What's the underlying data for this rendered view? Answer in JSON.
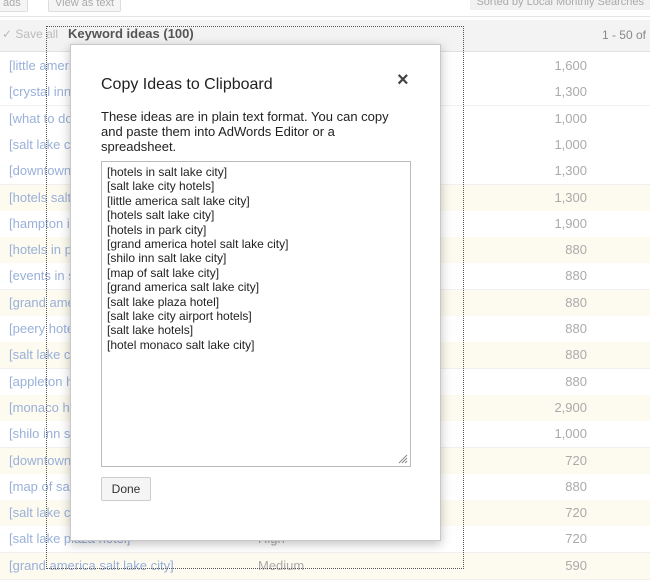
{
  "toolbar": {
    "left_button": "ads",
    "view_button": "View as text",
    "sorted_label": "Sorted by Local Monthly Searches"
  },
  "header": {
    "save_all": "Save all",
    "title": "Keyword ideas (100)",
    "range": "1 - 50 of"
  },
  "rows": [
    {
      "keyword": "[little america hotel]",
      "competition": "",
      "volume": "1,600"
    },
    {
      "keyword": "[crystal inn salt lake city]",
      "competition": "",
      "volume": "1,300"
    },
    {
      "keyword": "[what to do in salt lake city]",
      "competition": "",
      "volume": "1,000"
    },
    {
      "keyword": "[salt lake city hotels downtown]",
      "competition": "",
      "volume": "1,000"
    },
    {
      "keyword": "[downtown salt lake city hotels]",
      "competition": "",
      "volume": "1,300"
    },
    {
      "keyword": "[hotels salt lake city]",
      "competition": "",
      "volume": "1,300"
    },
    {
      "keyword": "[hampton inn salt lake city]",
      "competition": "",
      "volume": "1,900"
    },
    {
      "keyword": "[hotels in park city]",
      "competition": "",
      "volume": "880"
    },
    {
      "keyword": "[events in salt lake city]",
      "competition": "",
      "volume": "880"
    },
    {
      "keyword": "[grand america hotel]",
      "competition": "",
      "volume": "880"
    },
    {
      "keyword": "[peery hotel]",
      "competition": "",
      "volume": "880"
    },
    {
      "keyword": "[salt lake city airport hotels]",
      "competition": "",
      "volume": "880"
    },
    {
      "keyword": "[appleton hotel]",
      "competition": "",
      "volume": "880"
    },
    {
      "keyword": "[monaco hotel]",
      "competition": "",
      "volume": "2,900"
    },
    {
      "keyword": "[shilo inn salt lake city]",
      "competition": "",
      "volume": "1,000"
    },
    {
      "keyword": "[downtown salt lake hotels]",
      "competition": "",
      "volume": "720"
    },
    {
      "keyword": "[map of salt lake city]",
      "competition": "",
      "volume": "880"
    },
    {
      "keyword": "[salt lake city hotel]",
      "competition": "",
      "volume": "720"
    },
    {
      "keyword": "[salt lake plaza hotel]",
      "competition": "High",
      "volume": "720"
    },
    {
      "keyword": "[grand america salt lake city]",
      "competition": "Medium",
      "volume": "590"
    }
  ],
  "dialog": {
    "title": "Copy Ideas to Clipboard",
    "close_symbol": "×",
    "description": "These ideas are in plain text format. You can copy and paste them into AdWords Editor or a spreadsheet.",
    "ideas": [
      "[hotels in salt lake city]",
      "[salt lake city hotels]",
      "[little america salt lake city]",
      "[hotels salt lake city]",
      "[hotels in park city]",
      "[grand america hotel salt lake city]",
      "[shilo inn salt lake city]",
      "[map of salt lake city]",
      "[grand america salt lake city]",
      "[salt lake plaza hotel]",
      "[salt lake city airport hotels]",
      "[salt lake hotels]",
      "[hotel monaco salt lake city]"
    ],
    "done_label": "Done"
  }
}
